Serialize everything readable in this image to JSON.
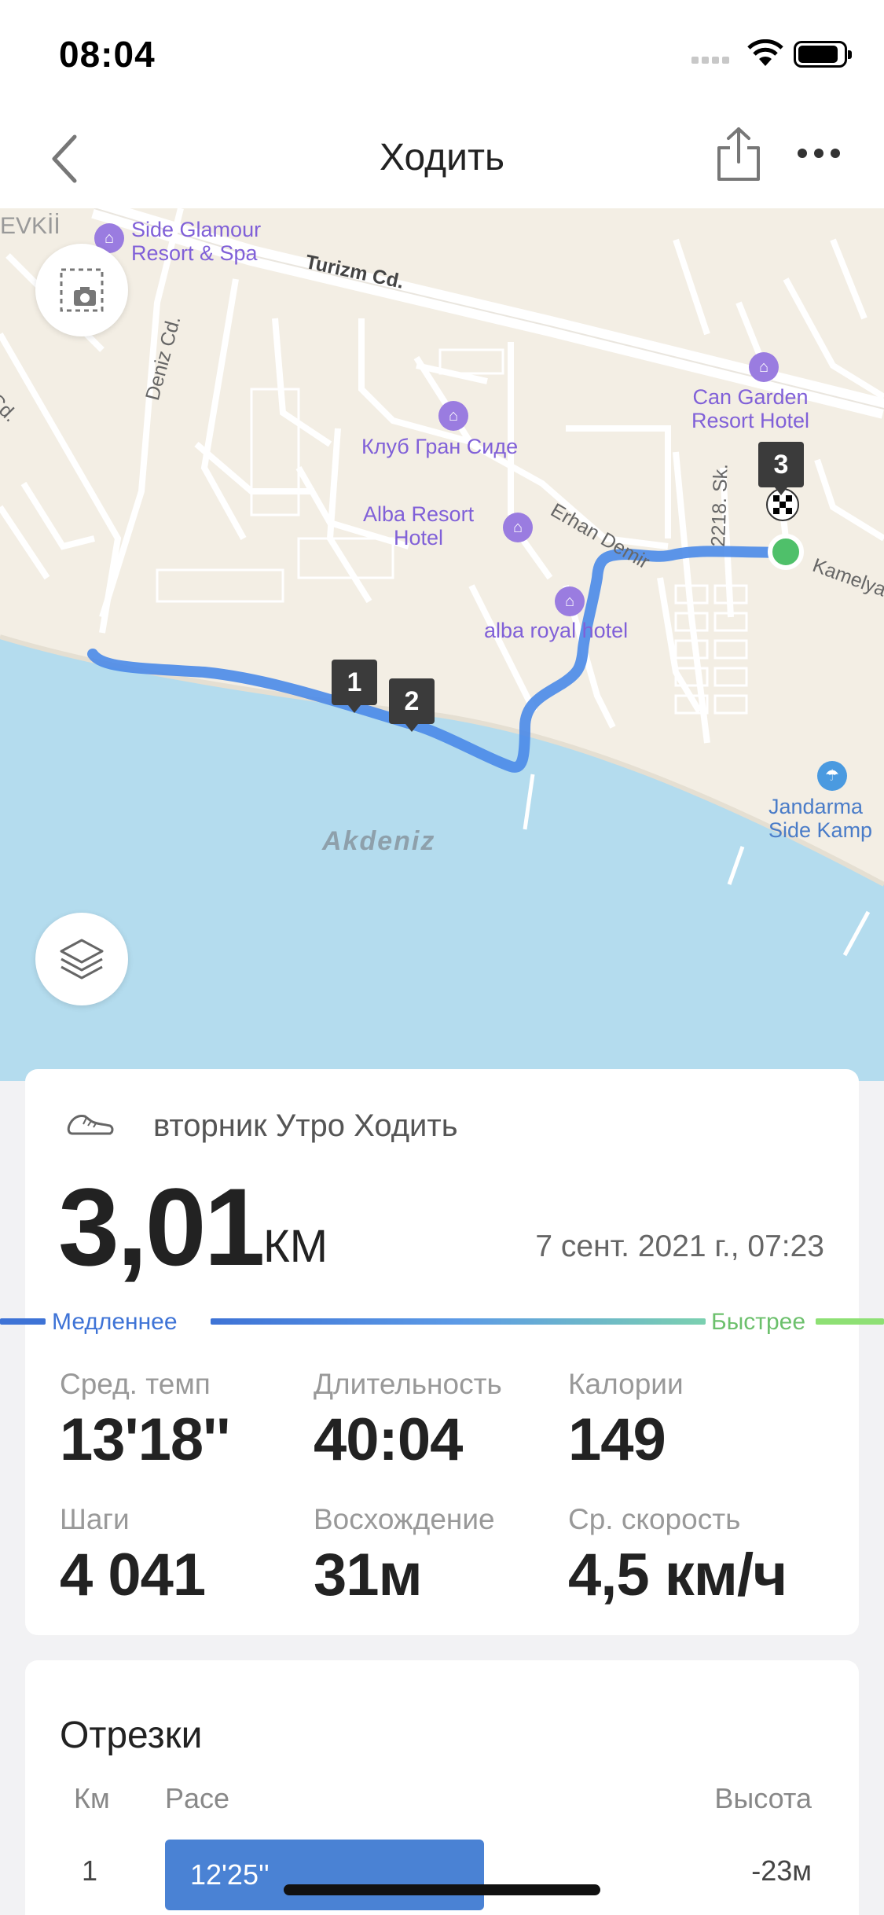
{
  "status_bar": {
    "time": "08:04"
  },
  "nav": {
    "title": "Ходить"
  },
  "map": {
    "pois": [
      {
        "name": "Side Glamour\nResort & Spa"
      },
      {
        "name": "Can Garden\nResort Hotel"
      },
      {
        "name": "Клуб Гран Сиде"
      },
      {
        "name": "Alba Resort\nHotel"
      },
      {
        "name": "alba royal hotel"
      },
      {
        "name": "Jandarma\nSide Kamp"
      }
    ],
    "streets": [
      "Turizm Cd.",
      "Deniz Cd.",
      "Cd.",
      "Erhan Demir",
      "2218. Sk.",
      "Kamelya",
      "EVKİİ"
    ],
    "sea_label": "Akdeniz",
    "lap_markers": [
      "1",
      "2",
      "3"
    ]
  },
  "summary": {
    "activity_label": "вторник Утро Ходить",
    "distance": "3,01",
    "distance_unit": "КМ",
    "datetime": "7 сент. 2021 г., 07:23",
    "pace_scale": {
      "slow": "Медленнее",
      "fast": "Быстрее"
    },
    "stats": [
      {
        "label": "Сред. темп",
        "value": "13'18''"
      },
      {
        "label": "Длительность",
        "value": "40:04"
      },
      {
        "label": "Калории",
        "value": "149"
      },
      {
        "label": "Шаги",
        "value": "4 041"
      },
      {
        "label": "Восхождение",
        "value": "31м"
      },
      {
        "label": "Ср. скорость",
        "value": "4,5 км/ч"
      }
    ]
  },
  "splits": {
    "title": "Отрезки",
    "columns": [
      "Км",
      "Pace",
      "Высота"
    ],
    "rows": [
      {
        "km": "1",
        "pace": "12'25''",
        "altitude": "-23м"
      }
    ]
  },
  "colors": {
    "accent": "#3e73d6",
    "route": "#4a8ae8",
    "sea": "#b4dcee",
    "land": "#f3eee4"
  }
}
